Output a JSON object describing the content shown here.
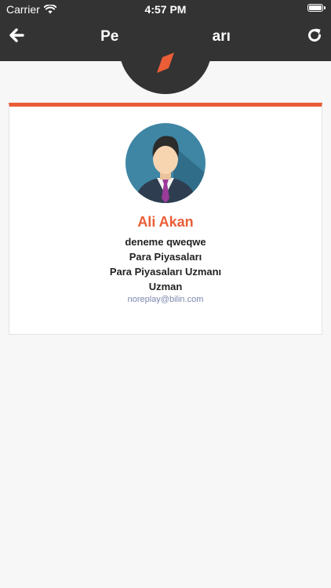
{
  "status_bar": {
    "carrier": "Carrier",
    "time": "4:57 PM"
  },
  "nav": {
    "title": "Personel Detayları",
    "back_icon": "arrow-left-icon",
    "refresh_icon": "refresh-icon"
  },
  "logo": {
    "color": "#ea5d37"
  },
  "profile": {
    "name": "Ali Akan",
    "lines": [
      "deneme qweqwe",
      "Para Piyasaları",
      "Para Piyasaları Uzmanı",
      "Uzman"
    ],
    "email": "noreplay@bilin.com"
  },
  "colors": {
    "header": "#333333",
    "accent": "#ea5d37",
    "email": "#7b86ad",
    "background": "#f7f7f7"
  }
}
